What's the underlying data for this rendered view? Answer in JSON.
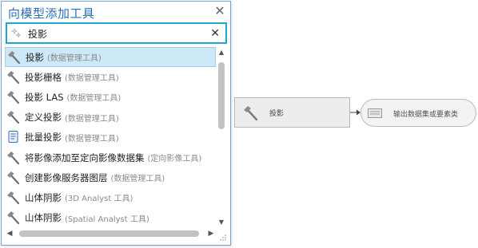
{
  "popup": {
    "title": "向模型添加工具",
    "close_glyph": "✕",
    "search": {
      "value": "投影",
      "clear_glyph": "✕",
      "icon": "sparkle-search-icon"
    },
    "results": [
      {
        "name": "投影",
        "toolbox": "(数据管理工具)",
        "icon": "hammer-icon",
        "selected": true
      },
      {
        "name": "投影栅格",
        "toolbox": "(数据管理工具)",
        "icon": "hammer-icon"
      },
      {
        "name": "投影 LAS",
        "toolbox": "(数据管理工具)",
        "icon": "hammer-icon"
      },
      {
        "name": "定义投影",
        "toolbox": "(数据管理工具)",
        "icon": "hammer-icon"
      },
      {
        "name": "批量投影",
        "toolbox": "(数据管理工具)",
        "icon": "script-icon"
      },
      {
        "name": "将影像添加至定向影像数据集",
        "toolbox": "(定向影像工具)",
        "icon": "hammer-icon"
      },
      {
        "name": "创建影像服务器图层",
        "toolbox": "(数据管理工具)",
        "icon": "hammer-icon"
      },
      {
        "name": "山体阴影",
        "toolbox": "(3D Analyst 工具)",
        "icon": "hammer-icon"
      },
      {
        "name": "山体阴影",
        "toolbox": "(Spatial Analyst 工具)",
        "icon": "hammer-icon"
      }
    ]
  },
  "diagram": {
    "tool_node": {
      "label": "投影",
      "icon": "hammer-icon"
    },
    "output_node": {
      "label": "输出数据集或要素类",
      "icon": "dataset-icon"
    }
  }
}
